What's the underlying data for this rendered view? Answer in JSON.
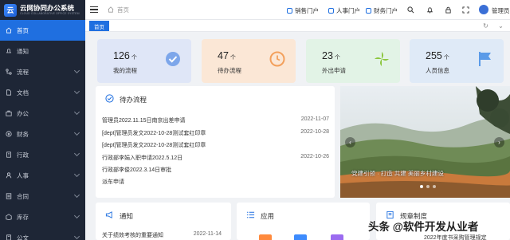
{
  "app": {
    "title": "云网协同办公系统",
    "subtitle": "CLOUD COLLABORATIVE OFFICE SYSTEM"
  },
  "sidebar": {
    "items": [
      {
        "label": "首页",
        "icon": "home-icon",
        "active": true
      },
      {
        "label": "通知",
        "icon": "bell-icon"
      },
      {
        "label": "流程",
        "icon": "flow-icon",
        "expandable": true
      },
      {
        "label": "文档",
        "icon": "document-icon",
        "expandable": true
      },
      {
        "label": "办公",
        "icon": "briefcase-icon",
        "expandable": true
      },
      {
        "label": "财务",
        "icon": "finance-icon",
        "expandable": true
      },
      {
        "label": "行政",
        "icon": "building-icon",
        "expandable": true
      },
      {
        "label": "人事",
        "icon": "person-icon",
        "expandable": true
      },
      {
        "label": "合同",
        "icon": "contract-icon",
        "expandable": true
      },
      {
        "label": "库存",
        "icon": "inventory-icon",
        "expandable": true
      },
      {
        "label": "公文",
        "icon": "official-doc-icon",
        "expandable": true
      }
    ]
  },
  "header": {
    "breadcrumb": "首页",
    "portals": [
      "销售门户",
      "人事门户",
      "财务门户"
    ],
    "user_name": "管理员"
  },
  "tabs": {
    "home_label": "首页"
  },
  "stats": [
    {
      "value": "126",
      "unit": "个",
      "label": "我的流程",
      "color": "#dfe6f7",
      "icon": "check-circle-icon"
    },
    {
      "value": "47",
      "unit": "个",
      "label": "待办流程",
      "color": "#fbe7d6",
      "icon": "clock-icon"
    },
    {
      "value": "23",
      "unit": "个",
      "label": "外出申请",
      "color": "#e2f3e6",
      "icon": "pinwheel-icon"
    },
    {
      "value": "255",
      "unit": "个",
      "label": "人员信息",
      "color": "#dfeaf7",
      "icon": "flag-icon"
    }
  ],
  "todo": {
    "title": "待办流程",
    "rows": [
      {
        "text": "管理员2022.11.15日南京出差申请",
        "date": "2022-11-07"
      },
      {
        "text": "[dept]管理员发文2022-10-28测试套红印章",
        "date": "2022-10-28"
      },
      {
        "text": "[dept]管理员发文2022-10-28测试套红印章",
        "date": ""
      },
      {
        "text": "行政部李娟入职申请2022.5.12日",
        "date": "2022-10-26"
      },
      {
        "text": "行政部李俊2022.3.14日审批",
        "date": ""
      },
      {
        "text": "派车申请",
        "date": ""
      }
    ]
  },
  "carousel": {
    "caption": "党建引领 · 打造 共建 美丽乡村建设",
    "dots": 3
  },
  "notice": {
    "title": "通知",
    "rows": [
      {
        "text": "关于绩效考核的重要通知",
        "date": "2022-11-14"
      }
    ]
  },
  "apps": {
    "title": "应用"
  },
  "rules": {
    "title": "规章制度",
    "rows": [
      {
        "text": "2022年度书采购管理规定"
      }
    ]
  },
  "watermark": "头条 @软件开发从业者"
}
